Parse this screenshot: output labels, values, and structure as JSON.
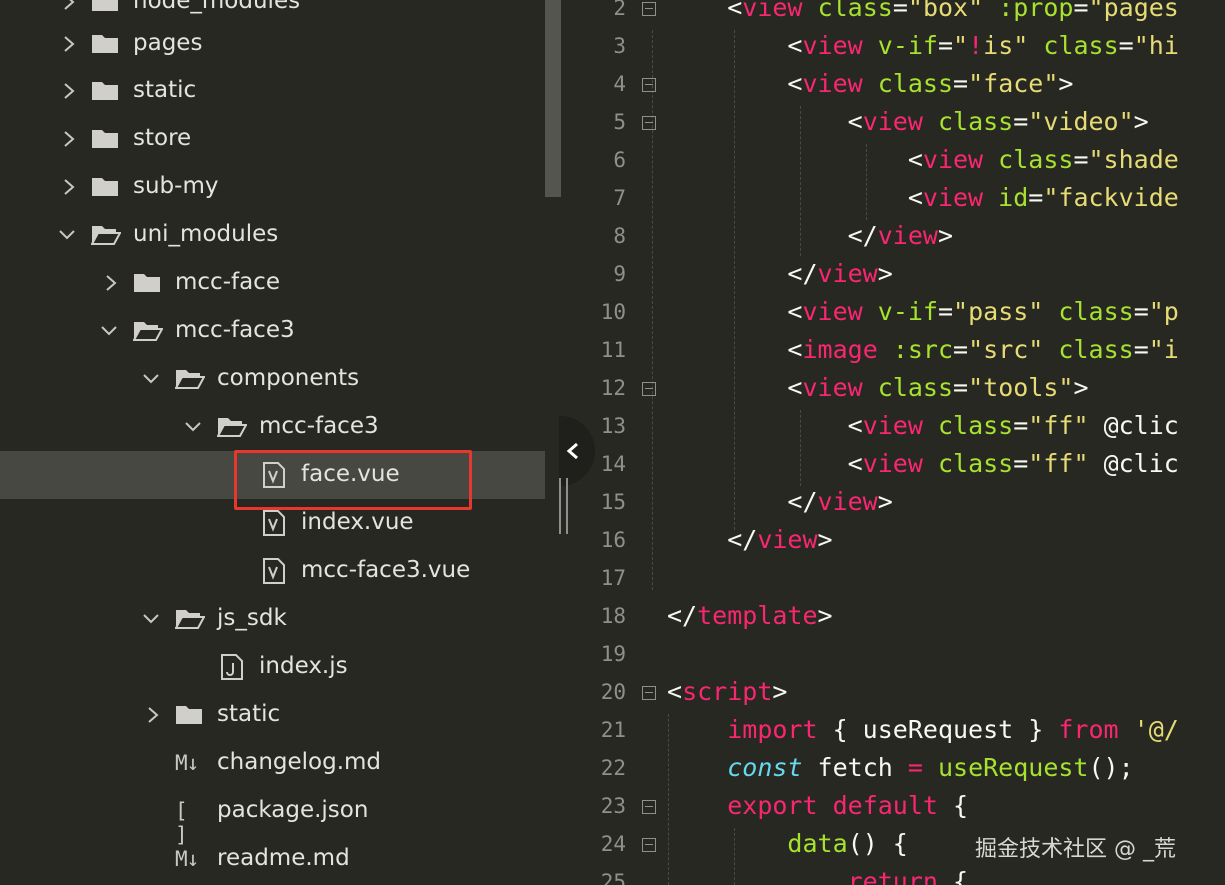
{
  "sidebar": {
    "items": [
      {
        "label": "node_modules",
        "type": "folder",
        "expanded": false
      },
      {
        "label": "pages",
        "type": "folder",
        "expanded": false
      },
      {
        "label": "static",
        "type": "folder",
        "expanded": false
      },
      {
        "label": "store",
        "type": "folder",
        "expanded": false
      },
      {
        "label": "sub-my",
        "type": "folder",
        "expanded": false
      },
      {
        "label": "uni_modules",
        "type": "folder",
        "expanded": true
      },
      {
        "label": "mcc-face",
        "type": "folder",
        "expanded": false
      },
      {
        "label": "mcc-face3",
        "type": "folder",
        "expanded": true
      },
      {
        "label": "components",
        "type": "folder",
        "expanded": true
      },
      {
        "label": "mcc-face3",
        "type": "folder",
        "expanded": true
      },
      {
        "label": "face.vue",
        "type": "vue-file",
        "selected": true
      },
      {
        "label": "index.vue",
        "type": "vue-file"
      },
      {
        "label": "mcc-face3.vue",
        "type": "vue-file"
      },
      {
        "label": "js_sdk",
        "type": "folder",
        "expanded": true
      },
      {
        "label": "index.js",
        "type": "js-file"
      },
      {
        "label": "static",
        "type": "folder",
        "expanded": false
      },
      {
        "label": "changelog.md",
        "type": "md-file"
      },
      {
        "label": "package.json",
        "type": "json-file"
      },
      {
        "label": "readme.md",
        "type": "md-file"
      }
    ],
    "file_glyphs": {
      "md": "M↓",
      "json": "[ ]"
    }
  },
  "editor": {
    "lines": [
      {
        "n": "2",
        "text": "    <view class=\"box\" :prop=\"pages"
      },
      {
        "n": "3",
        "text": "        <view v-if=\"!is\" class=\"hi"
      },
      {
        "n": "4",
        "text": "        <view class=\"face\">"
      },
      {
        "n": "5",
        "text": "            <view class=\"video\">"
      },
      {
        "n": "6",
        "text": "                <view class=\"shade"
      },
      {
        "n": "7",
        "text": "                <view id=\"fackvide"
      },
      {
        "n": "8",
        "text": "            </view>"
      },
      {
        "n": "9",
        "text": "        </view>"
      },
      {
        "n": "10",
        "text": "        <view v-if=\"pass\" class=\"p"
      },
      {
        "n": "11",
        "text": "        <image :src=\"src\" class=\"i"
      },
      {
        "n": "12",
        "text": "        <view class=\"tools\">"
      },
      {
        "n": "13",
        "text": "            <view class=\"ff\" @clic"
      },
      {
        "n": "14",
        "text": "            <view class=\"ff\" @clic"
      },
      {
        "n": "15",
        "text": "        </view>"
      },
      {
        "n": "16",
        "text": "    </view>"
      },
      {
        "n": "17",
        "text": ""
      },
      {
        "n": "18",
        "text": "</template>"
      },
      {
        "n": "19",
        "text": ""
      },
      {
        "n": "20",
        "text": "<script>"
      },
      {
        "n": "21",
        "text": "    import { useRequest } from '@/"
      },
      {
        "n": "22",
        "text": "    const fetch = useRequest();"
      },
      {
        "n": "23",
        "text": "    export default {"
      },
      {
        "n": "24",
        "text": "        data() {"
      },
      {
        "n": "25",
        "text": "            return {"
      }
    ]
  },
  "watermark": "掘金技术社区 @ _荒",
  "colors": {
    "background": "#272822",
    "selected_row": "#484843",
    "highlight_box": "#e8372d",
    "tag": "#f92672",
    "attr": "#a6e22e",
    "string": "#e6db74"
  },
  "icons": {
    "collapse": "chevron-left-icon",
    "folder_closed": "folder-icon",
    "folder_open": "folder-open-icon",
    "vue_file": "vue-file-icon",
    "js_file": "js-file-icon"
  }
}
